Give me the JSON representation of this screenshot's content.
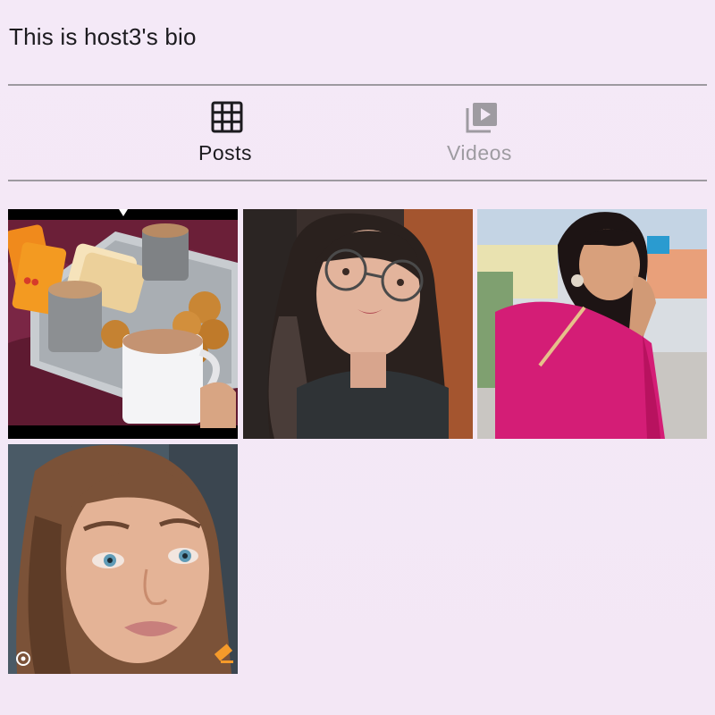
{
  "profile": {
    "bio": "This is host3's bio"
  },
  "tabs": [
    {
      "label": "Posts",
      "icon": "grid-icon",
      "selected": true
    },
    {
      "label": "Videos",
      "icon": "video-library-icon",
      "selected": false
    }
  ],
  "colors": {
    "background": "#f3e8f6",
    "text_primary": "#1c1b1f",
    "text_muted": "#9e9ba1",
    "divider": "#9d9aa0"
  },
  "posts": [
    {
      "icon": "tea-and-biscuits-photo"
    },
    {
      "icon": "girl-with-glasses-photo"
    },
    {
      "icon": "woman-in-pink-saree-photo"
    },
    {
      "icon": "woman-portrait-photo"
    }
  ]
}
